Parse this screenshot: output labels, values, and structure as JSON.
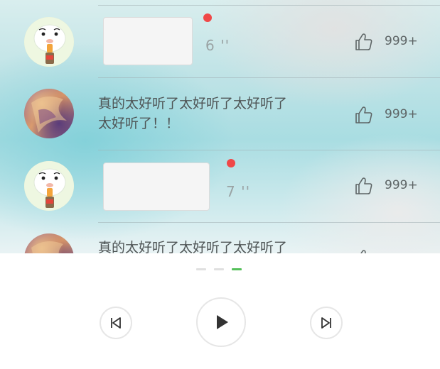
{
  "comments": [
    {
      "type": "voice",
      "duration": "6 ''",
      "likes": "999+"
    },
    {
      "type": "text",
      "text_line1": "真的太好听了太好听了太好听了",
      "text_line2": "太好听了！！",
      "likes": "999+"
    },
    {
      "type": "voice",
      "duration": "7 ''",
      "likes": "999+"
    },
    {
      "type": "text",
      "text_line1": "真的太好听了太好听了太好听了"
    }
  ],
  "player": {
    "pages": 3,
    "active_page": 3,
    "icons": {
      "prev": "skip-previous-icon",
      "play": "play-icon",
      "next": "skip-next-icon"
    }
  },
  "colors": {
    "accent": "#55c05a",
    "unread": "#f04848"
  }
}
